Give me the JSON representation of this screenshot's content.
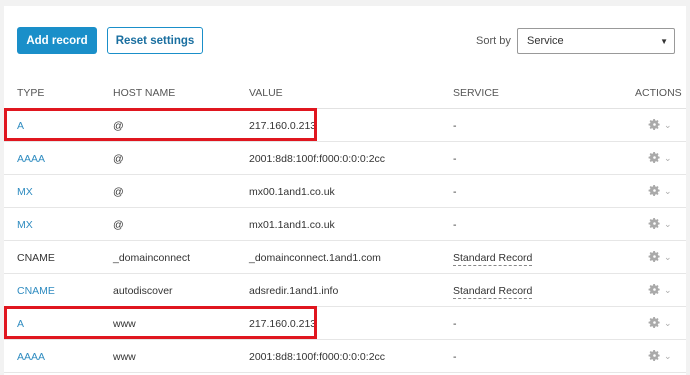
{
  "toolbar": {
    "add_record_label": "Add record",
    "reset_settings_label": "Reset settings",
    "sort_by_label": "Sort by",
    "sort_by_value": "Service"
  },
  "table": {
    "headers": {
      "type": "TYPE",
      "host": "HOST NAME",
      "value": "VALUE",
      "service": "SERVICE",
      "actions": "ACTIONS"
    },
    "rows": [
      {
        "type": "A",
        "host": "@",
        "value": "217.160.0.213",
        "service": "-",
        "highlighted": true
      },
      {
        "type": "AAAA",
        "host": "@",
        "value": "2001:8d8:100f:f000:0:0:0:2cc",
        "service": "-"
      },
      {
        "type": "MX",
        "host": "@",
        "value": "mx00.1and1.co.uk",
        "service": "-"
      },
      {
        "type": "MX",
        "host": "@",
        "value": "mx01.1and1.co.uk",
        "service": "-"
      },
      {
        "type": "CNAME",
        "host": "_domainconnect",
        "value": "_domainconnect.1and1.com",
        "service": "Standard Record"
      },
      {
        "type": "CNAME",
        "host": "autodiscover",
        "value": "adsredir.1and1.info",
        "service": "Standard Record"
      },
      {
        "type": "A",
        "host": "www",
        "value": "217.160.0.213",
        "service": "-",
        "highlighted": true
      },
      {
        "type": "AAAA",
        "host": "www",
        "value": "2001:8d8:100f:f000:0:0:0:2cc",
        "service": "-"
      }
    ]
  },
  "colors": {
    "accent": "#1a8fc9",
    "link": "#2e8bc0",
    "highlight": "#e0161f"
  },
  "icons": {
    "actions": "gear-icon",
    "dropdown": "chevron-down-icon"
  }
}
